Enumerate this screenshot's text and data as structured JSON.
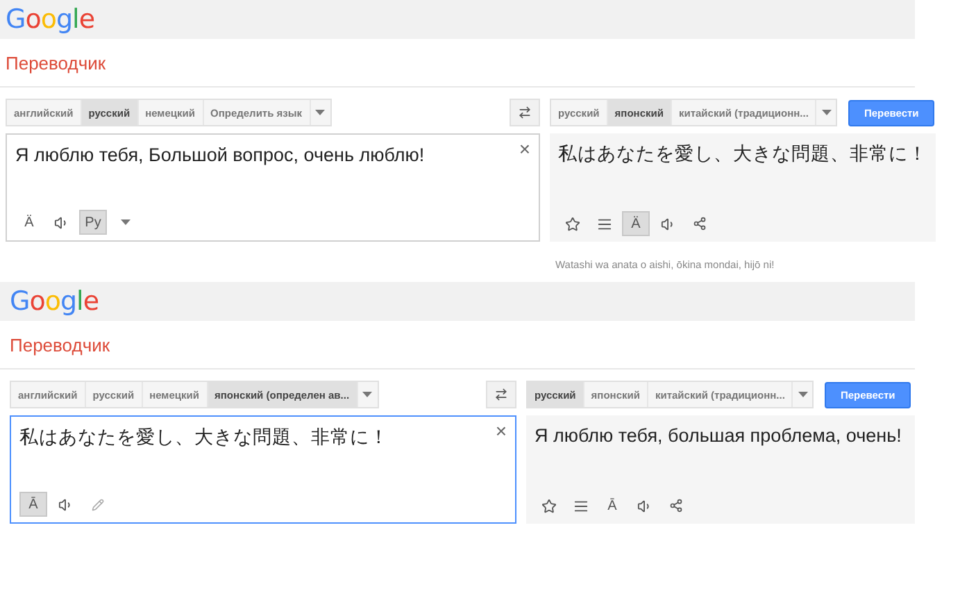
{
  "panels": [
    {
      "logo": "Google",
      "title": "Переводчик",
      "source_langs": [
        {
          "label": "английский",
          "selected": false
        },
        {
          "label": "русский",
          "selected": true
        },
        {
          "label": "немецкий",
          "selected": false
        },
        {
          "label": "Определить язык",
          "selected": false
        }
      ],
      "target_langs": [
        {
          "label": "русский",
          "selected": false
        },
        {
          "label": "японский",
          "selected": true
        },
        {
          "label": "китайский (традиционн...",
          "selected": false
        }
      ],
      "translate_button": "Перевести",
      "source": {
        "text": "Я люблю тебя, Большой вопрос, очень люблю!",
        "clear": "×",
        "focused": false,
        "tools": [
          {
            "kind": "glyph",
            "glyph": "Ä",
            "selected": false
          },
          {
            "kind": "listen",
            "selected": false
          },
          {
            "kind": "glyph",
            "glyph": "Ру",
            "selected": true
          },
          {
            "kind": "caret",
            "selected": false
          }
        ]
      },
      "result": {
        "text": "私はあなたを愛し、大きな問題、非常に！",
        "tools": [
          {
            "kind": "star",
            "selected": false
          },
          {
            "kind": "phrasebook",
            "selected": false
          },
          {
            "kind": "glyph",
            "glyph": "Ä",
            "selected": true
          },
          {
            "kind": "listen",
            "selected": false
          },
          {
            "kind": "share",
            "selected": false
          }
        ]
      },
      "romanization": "Watashi wa anata o aishi, ōkina mondai, hijō ni!"
    },
    {
      "logo": "Google",
      "title": "Переводчик",
      "source_langs": [
        {
          "label": "английский",
          "selected": false
        },
        {
          "label": "русский",
          "selected": false
        },
        {
          "label": "немецкий",
          "selected": false
        },
        {
          "label": "японский (определен ав...",
          "selected": true
        }
      ],
      "target_langs": [
        {
          "label": "русский",
          "selected": true
        },
        {
          "label": "японский",
          "selected": false
        },
        {
          "label": "китайский (традиционн...",
          "selected": false
        }
      ],
      "translate_button": "Перевести",
      "source": {
        "text": "私はあなたを愛し、大きな問題、非常に！",
        "clear": "×",
        "focused": true,
        "tools": [
          {
            "kind": "glyph",
            "glyph": "Ā",
            "selected": true
          },
          {
            "kind": "listen",
            "selected": false
          },
          {
            "kind": "edit",
            "selected": false
          }
        ]
      },
      "result": {
        "text": "Я люблю тебя, большая проблема, очень!",
        "tools": [
          {
            "kind": "star",
            "selected": false
          },
          {
            "kind": "phrasebook",
            "selected": false
          },
          {
            "kind": "glyph",
            "glyph": "Ā",
            "selected": false
          },
          {
            "kind": "listen",
            "selected": false
          },
          {
            "kind": "share",
            "selected": false
          }
        ]
      }
    }
  ]
}
